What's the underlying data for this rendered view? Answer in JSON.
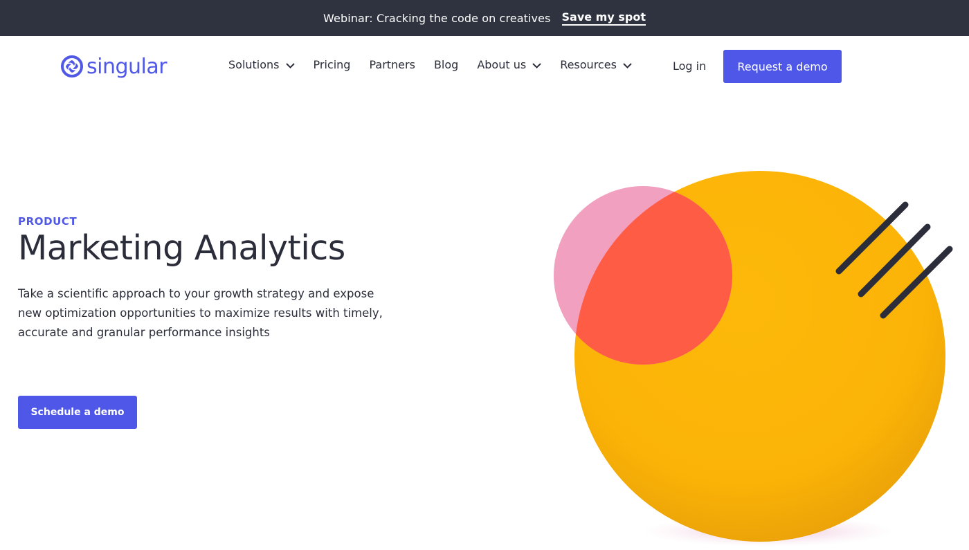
{
  "announcement": {
    "message": "Webinar: Cracking the code on creatives",
    "cta": "Save my spot"
  },
  "header": {
    "logo_text": "singular",
    "nav": [
      {
        "label": "Solutions",
        "has_dropdown": true
      },
      {
        "label": "Pricing",
        "has_dropdown": false
      },
      {
        "label": "Partners",
        "has_dropdown": false
      },
      {
        "label": "Blog",
        "has_dropdown": false
      },
      {
        "label": "About us",
        "has_dropdown": true
      },
      {
        "label": "Resources",
        "has_dropdown": true
      }
    ],
    "login": "Log in",
    "demo_button": "Request a demo"
  },
  "hero": {
    "eyebrow": "PRODUCT",
    "title": "Marketing Analytics",
    "description": "Take a scientific approach to your growth strategy and expose new optimization opportunities to maximize results with timely, accurate and granular performance insights",
    "cta": "Schedule a demo"
  },
  "icons": [
    "singular-logo-icon",
    "chevron-down-icon"
  ],
  "colors": {
    "brand": "#4f57e8",
    "dark_bar": "#2f3340",
    "text": "#2b2d3a",
    "yellow": "#fbb307",
    "pink": "#f2a0c0",
    "overlap": "#ff5c45"
  }
}
